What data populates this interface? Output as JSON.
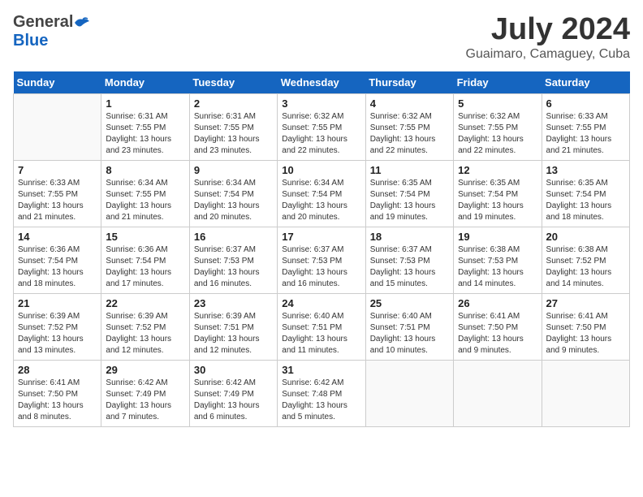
{
  "header": {
    "logo_general": "General",
    "logo_blue": "Blue",
    "month": "July 2024",
    "location": "Guaimaro, Camaguey, Cuba"
  },
  "days_of_week": [
    "Sunday",
    "Monday",
    "Tuesday",
    "Wednesday",
    "Thursday",
    "Friday",
    "Saturday"
  ],
  "weeks": [
    [
      {
        "day": "",
        "sunrise": "",
        "sunset": "",
        "daylight": ""
      },
      {
        "day": "1",
        "sunrise": "Sunrise: 6:31 AM",
        "sunset": "Sunset: 7:55 PM",
        "daylight": "Daylight: 13 hours and 23 minutes."
      },
      {
        "day": "2",
        "sunrise": "Sunrise: 6:31 AM",
        "sunset": "Sunset: 7:55 PM",
        "daylight": "Daylight: 13 hours and 23 minutes."
      },
      {
        "day": "3",
        "sunrise": "Sunrise: 6:32 AM",
        "sunset": "Sunset: 7:55 PM",
        "daylight": "Daylight: 13 hours and 22 minutes."
      },
      {
        "day": "4",
        "sunrise": "Sunrise: 6:32 AM",
        "sunset": "Sunset: 7:55 PM",
        "daylight": "Daylight: 13 hours and 22 minutes."
      },
      {
        "day": "5",
        "sunrise": "Sunrise: 6:32 AM",
        "sunset": "Sunset: 7:55 PM",
        "daylight": "Daylight: 13 hours and 22 minutes."
      },
      {
        "day": "6",
        "sunrise": "Sunrise: 6:33 AM",
        "sunset": "Sunset: 7:55 PM",
        "daylight": "Daylight: 13 hours and 21 minutes."
      }
    ],
    [
      {
        "day": "7",
        "sunrise": "Sunrise: 6:33 AM",
        "sunset": "Sunset: 7:55 PM",
        "daylight": "Daylight: 13 hours and 21 minutes."
      },
      {
        "day": "8",
        "sunrise": "Sunrise: 6:34 AM",
        "sunset": "Sunset: 7:55 PM",
        "daylight": "Daylight: 13 hours and 21 minutes."
      },
      {
        "day": "9",
        "sunrise": "Sunrise: 6:34 AM",
        "sunset": "Sunset: 7:54 PM",
        "daylight": "Daylight: 13 hours and 20 minutes."
      },
      {
        "day": "10",
        "sunrise": "Sunrise: 6:34 AM",
        "sunset": "Sunset: 7:54 PM",
        "daylight": "Daylight: 13 hours and 20 minutes."
      },
      {
        "day": "11",
        "sunrise": "Sunrise: 6:35 AM",
        "sunset": "Sunset: 7:54 PM",
        "daylight": "Daylight: 13 hours and 19 minutes."
      },
      {
        "day": "12",
        "sunrise": "Sunrise: 6:35 AM",
        "sunset": "Sunset: 7:54 PM",
        "daylight": "Daylight: 13 hours and 19 minutes."
      },
      {
        "day": "13",
        "sunrise": "Sunrise: 6:35 AM",
        "sunset": "Sunset: 7:54 PM",
        "daylight": "Daylight: 13 hours and 18 minutes."
      }
    ],
    [
      {
        "day": "14",
        "sunrise": "Sunrise: 6:36 AM",
        "sunset": "Sunset: 7:54 PM",
        "daylight": "Daylight: 13 hours and 18 minutes."
      },
      {
        "day": "15",
        "sunrise": "Sunrise: 6:36 AM",
        "sunset": "Sunset: 7:54 PM",
        "daylight": "Daylight: 13 hours and 17 minutes."
      },
      {
        "day": "16",
        "sunrise": "Sunrise: 6:37 AM",
        "sunset": "Sunset: 7:53 PM",
        "daylight": "Daylight: 13 hours and 16 minutes."
      },
      {
        "day": "17",
        "sunrise": "Sunrise: 6:37 AM",
        "sunset": "Sunset: 7:53 PM",
        "daylight": "Daylight: 13 hours and 16 minutes."
      },
      {
        "day": "18",
        "sunrise": "Sunrise: 6:37 AM",
        "sunset": "Sunset: 7:53 PM",
        "daylight": "Daylight: 13 hours and 15 minutes."
      },
      {
        "day": "19",
        "sunrise": "Sunrise: 6:38 AM",
        "sunset": "Sunset: 7:53 PM",
        "daylight": "Daylight: 13 hours and 14 minutes."
      },
      {
        "day": "20",
        "sunrise": "Sunrise: 6:38 AM",
        "sunset": "Sunset: 7:52 PM",
        "daylight": "Daylight: 13 hours and 14 minutes."
      }
    ],
    [
      {
        "day": "21",
        "sunrise": "Sunrise: 6:39 AM",
        "sunset": "Sunset: 7:52 PM",
        "daylight": "Daylight: 13 hours and 13 minutes."
      },
      {
        "day": "22",
        "sunrise": "Sunrise: 6:39 AM",
        "sunset": "Sunset: 7:52 PM",
        "daylight": "Daylight: 13 hours and 12 minutes."
      },
      {
        "day": "23",
        "sunrise": "Sunrise: 6:39 AM",
        "sunset": "Sunset: 7:51 PM",
        "daylight": "Daylight: 13 hours and 12 minutes."
      },
      {
        "day": "24",
        "sunrise": "Sunrise: 6:40 AM",
        "sunset": "Sunset: 7:51 PM",
        "daylight": "Daylight: 13 hours and 11 minutes."
      },
      {
        "day": "25",
        "sunrise": "Sunrise: 6:40 AM",
        "sunset": "Sunset: 7:51 PM",
        "daylight": "Daylight: 13 hours and 10 minutes."
      },
      {
        "day": "26",
        "sunrise": "Sunrise: 6:41 AM",
        "sunset": "Sunset: 7:50 PM",
        "daylight": "Daylight: 13 hours and 9 minutes."
      },
      {
        "day": "27",
        "sunrise": "Sunrise: 6:41 AM",
        "sunset": "Sunset: 7:50 PM",
        "daylight": "Daylight: 13 hours and 9 minutes."
      }
    ],
    [
      {
        "day": "28",
        "sunrise": "Sunrise: 6:41 AM",
        "sunset": "Sunset: 7:50 PM",
        "daylight": "Daylight: 13 hours and 8 minutes."
      },
      {
        "day": "29",
        "sunrise": "Sunrise: 6:42 AM",
        "sunset": "Sunset: 7:49 PM",
        "daylight": "Daylight: 13 hours and 7 minutes."
      },
      {
        "day": "30",
        "sunrise": "Sunrise: 6:42 AM",
        "sunset": "Sunset: 7:49 PM",
        "daylight": "Daylight: 13 hours and 6 minutes."
      },
      {
        "day": "31",
        "sunrise": "Sunrise: 6:42 AM",
        "sunset": "Sunset: 7:48 PM",
        "daylight": "Daylight: 13 hours and 5 minutes."
      },
      {
        "day": "",
        "sunrise": "",
        "sunset": "",
        "daylight": ""
      },
      {
        "day": "",
        "sunrise": "",
        "sunset": "",
        "daylight": ""
      },
      {
        "day": "",
        "sunrise": "",
        "sunset": "",
        "daylight": ""
      }
    ]
  ]
}
